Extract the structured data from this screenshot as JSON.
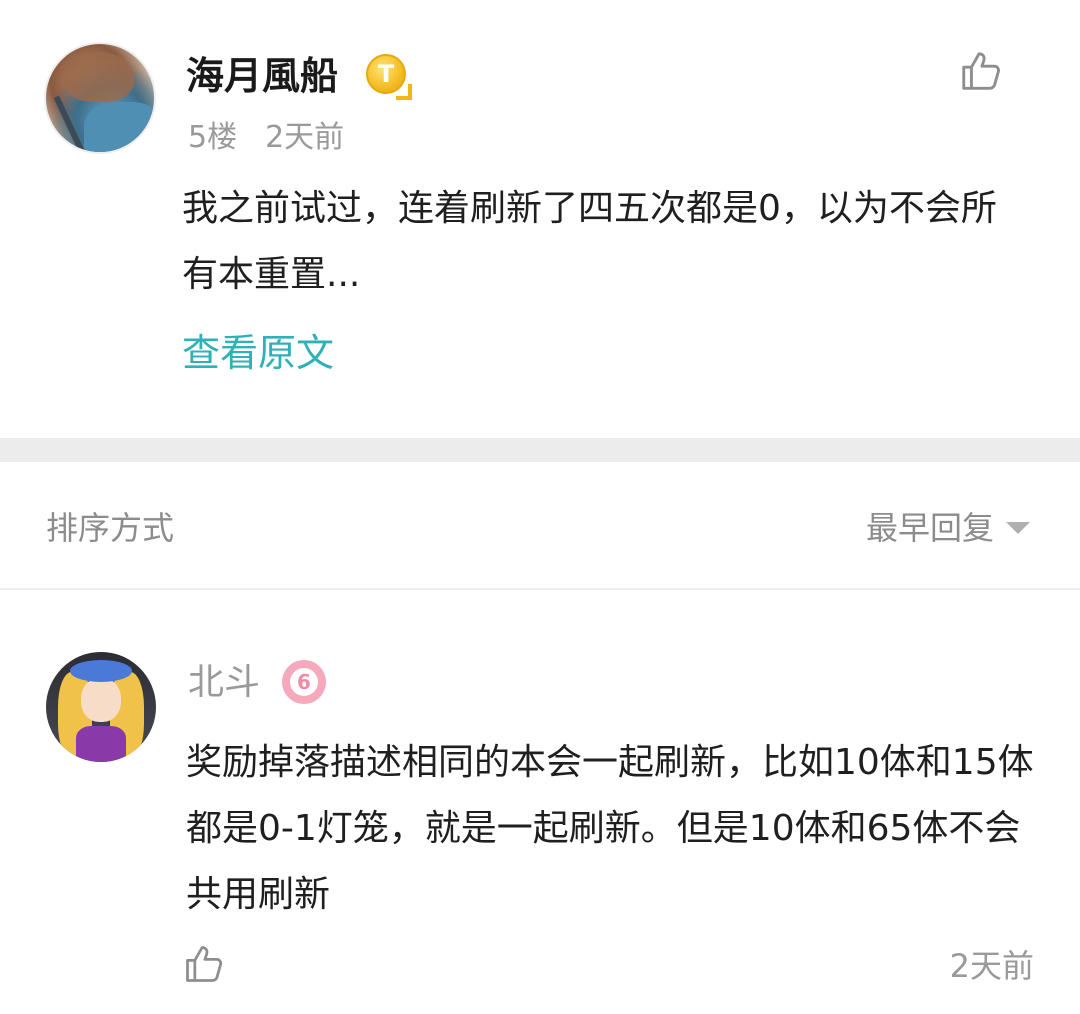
{
  "post": {
    "username": "海月風船",
    "badge_letter": "T",
    "floor": "5楼",
    "time": "2天前",
    "content": "我之前试过，连着刷新了四五次都是0，以为不会所有本重置...",
    "view_original": "查看原文"
  },
  "sort": {
    "label": "排序方式",
    "selected": "最早回复"
  },
  "reply": {
    "username": "北斗",
    "level_glyph": "6",
    "content": "奖励掉落描述相同的本会一起刷新，比如10体和15体都是0-1灯笼，就是一起刷新。但是10体和65体不会共用刷新",
    "time": "2天前"
  },
  "colors": {
    "accent_link": "#2fb1b8",
    "badge_gold": "#f5c02a",
    "level_pink": "#f6a9bc",
    "separator": "#ececec"
  },
  "icons": [
    "thumbs-up-icon",
    "gold-t-badge-icon",
    "level-badge-icon",
    "caret-down-icon"
  ]
}
